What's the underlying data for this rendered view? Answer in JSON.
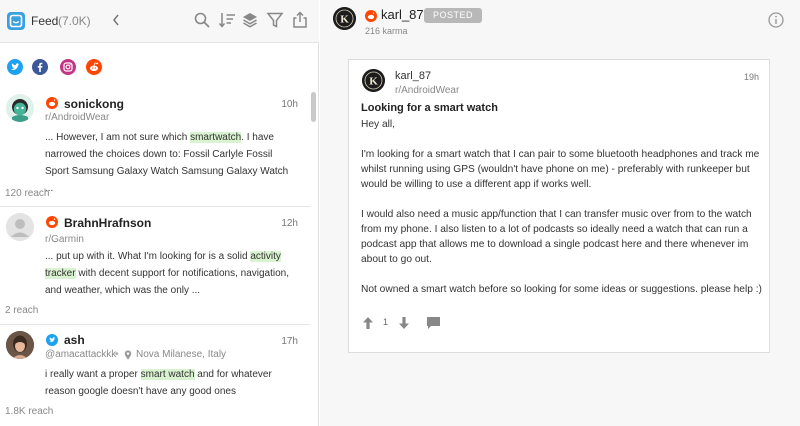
{
  "left_header": {
    "feed_label": "Feed",
    "feed_count": "(7.0K)"
  },
  "social_filters": [
    {
      "icon": "twitter-icon",
      "color": "#1da1f2"
    },
    {
      "icon": "facebook-icon",
      "color": "#3b5998"
    },
    {
      "icon": "instagram-icon",
      "color": "#c13584"
    },
    {
      "icon": "reddit-icon",
      "color": "#ff4500"
    }
  ],
  "posts": [
    {
      "author": "sonickong",
      "subreddit": "r/AndroidWear",
      "time": "10h",
      "snippet_before": "... However, I am not sure which ",
      "snippet_highlight": "smartwatch",
      "snippet_after": ". I have narrowed the choices down to: Fossil Carlyle Fossil Sport Samsung Galaxy Watch Samsung Galaxy Watch ...",
      "reach": "120 reach"
    },
    {
      "author": "BrahnHrafnson",
      "subreddit": "r/Garmin",
      "time": "12h",
      "snippet_before": "... put up with it. What I'm looking for is a solid ",
      "snippet_highlight": "activity tracker",
      "snippet_after": " with decent support for notifications, navigation, and weather, which was the only ...",
      "reach": "2 reach"
    },
    {
      "author": "ash",
      "handle": "@amacattackkk",
      "location": "Nova Milanese, Italy",
      "time": "17h",
      "snippet_before": "i really want a proper ",
      "snippet_highlight": "smart watch",
      "snippet_after": " and for whatever reason google doesn't have any good ones",
      "reach": "1.8K reach"
    }
  ],
  "detail_header": {
    "username": "karl_87",
    "status": "POSTED",
    "karma": "216 karma"
  },
  "detail_card": {
    "username": "karl_87",
    "subreddit": "r/AndroidWear",
    "time": "19h",
    "title": "Looking for a smart watch",
    "greeting": "Hey all,",
    "paragraphs": [
      "I'm looking for a smart watch that I can pair to some bluetooth headphones and track me whilst running using GPS (wouldn't have phone on me) - preferably with runkeeper but would be willing to use a different app if works well.",
      "I would also need a music app/function that I can transfer music over from to the watch from my phone. I also listen to a lot of podcasts so ideally need a watch that can run a podcast app that allows me to download a single podcast here and there whenever im about to go out.",
      "Not owned a smart watch before so looking for some ideas or suggestions. please help :)"
    ],
    "vote_count": "1"
  },
  "colors": {
    "reddit": "#ff4500",
    "twitter": "#1da1f2",
    "highlight": "#d9f2d0"
  }
}
